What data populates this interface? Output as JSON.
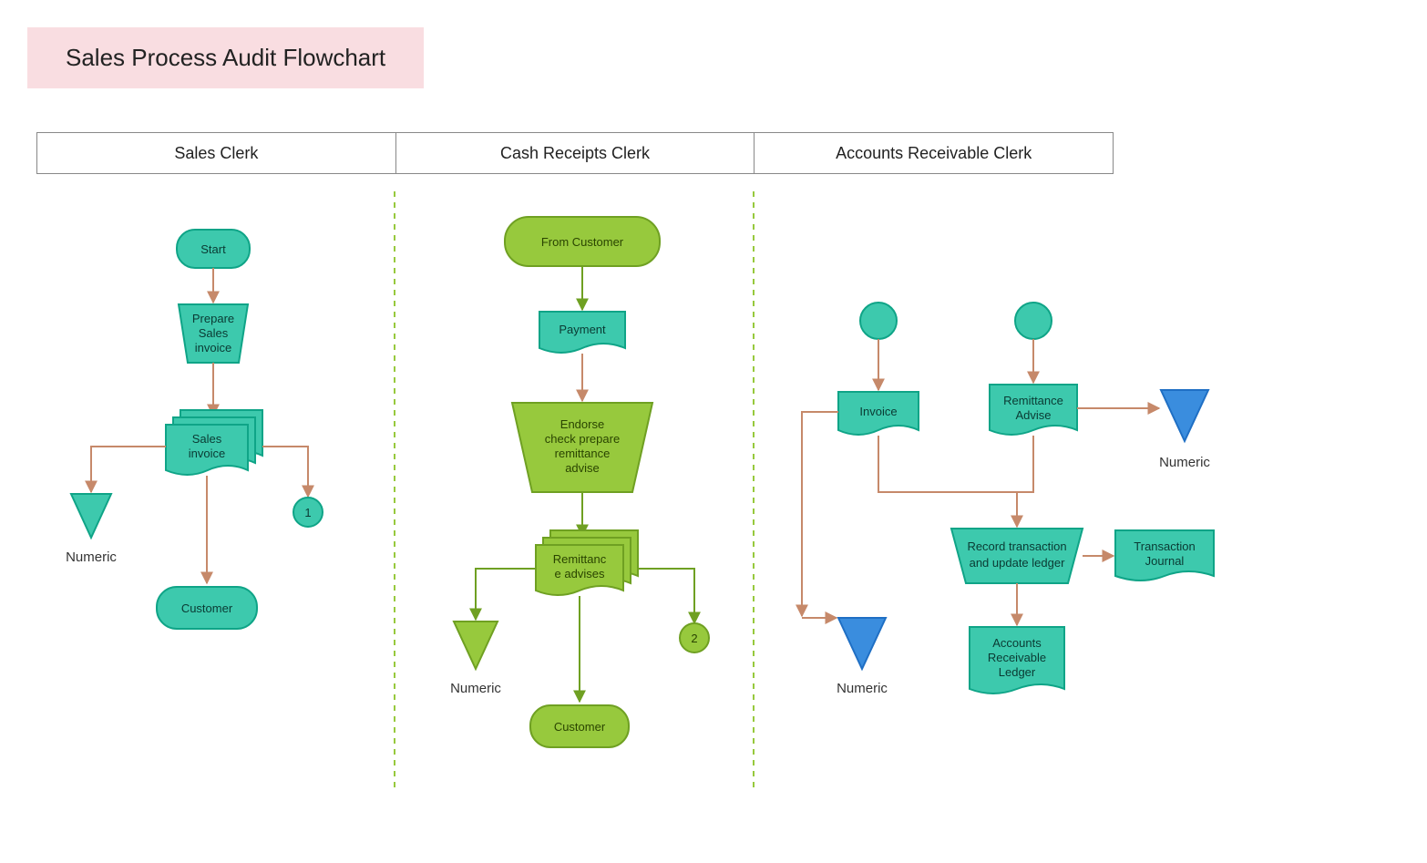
{
  "title": "Sales Process Audit Flowchart",
  "lanes": {
    "col1": "Sales Clerk",
    "col2": "Cash Receipts Clerk",
    "col3": "Accounts Receivable Clerk"
  },
  "col1": {
    "start": "Start",
    "prep1": "Prepare",
    "prep2": "Sales",
    "prep3": "invoice",
    "doc1": "Sales",
    "doc2": "invoice",
    "conn": "1",
    "numeric": "Numeric",
    "customer": "Customer"
  },
  "col2": {
    "from": "From Customer",
    "payment": "Payment",
    "endorse1": "Endorse",
    "endorse2": "check prepare",
    "endorse3": "remittance",
    "endorse4": "advise",
    "remit1": "Remittanc",
    "remit2": "e advises",
    "conn": "2",
    "numeric": "Numeric",
    "customer": "Customer"
  },
  "col3": {
    "invoice": "Invoice",
    "remit1": "Remittance",
    "remit2": "Advise",
    "numericR": "Numeric",
    "numericL": "Numeric",
    "rec1": "Record transaction",
    "rec2": "and update ledger",
    "trans1": "Transaction",
    "trans2": "Journal",
    "ledger1": "Accounts",
    "ledger2": "Receivable",
    "ledger3": "Ledger"
  },
  "colors": {
    "teal": {
      "fill": "#3dc9ad",
      "stroke": "#0fa487"
    },
    "green": {
      "fill": "#97c93d",
      "stroke": "#6fa022"
    },
    "blue": {
      "fill": "#3a8dde",
      "stroke": "#1f6fc4"
    },
    "arrowTeal": "#c6896a",
    "arrowGreen": "#6fa022",
    "divider": "#97c93d"
  }
}
